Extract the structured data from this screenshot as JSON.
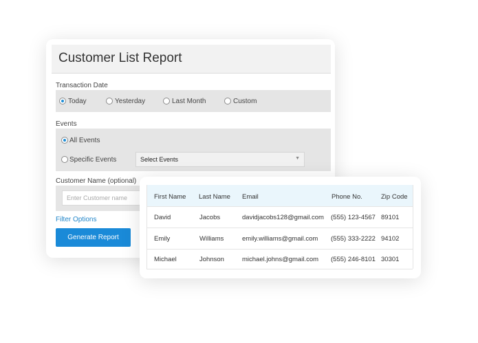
{
  "report": {
    "title": "Customer List Report",
    "transaction_date": {
      "label": "Transaction Date",
      "options": [
        "Today",
        "Yesterday",
        "Last Month",
        "Custom"
      ],
      "selected": "Today"
    },
    "events": {
      "label": "Events",
      "all_label": "All Events",
      "specific_label": "Specific Events",
      "selected": "All Events",
      "select_value": "Select Events"
    },
    "customer_name": {
      "label": "Customer Name (optional)",
      "placeholder": "Enter Customer name"
    },
    "filter_link": "Filter Options",
    "generate_button": "Generate Report"
  },
  "table": {
    "columns": [
      "First Name",
      "Last Name",
      "Email",
      "Phone No.",
      "Zip Code"
    ],
    "rows": [
      [
        "David",
        "Jacobs",
        "davidjacobs128@gmail.com",
        "(555) 123-4567",
        "89101"
      ],
      [
        "Emily",
        "Williams",
        "emily.williams@gmail.com",
        "(555) 333-2222",
        "94102"
      ],
      [
        "Michael",
        "Johnson",
        "michael.johns@gmail.com",
        "(555) 246-8101",
        "30301"
      ]
    ]
  },
  "colors": {
    "accent": "#1a8ad8",
    "link": "#2085c9",
    "table_header_bg": "#eaf6fc",
    "panel_bg": "#e5e5e5"
  }
}
